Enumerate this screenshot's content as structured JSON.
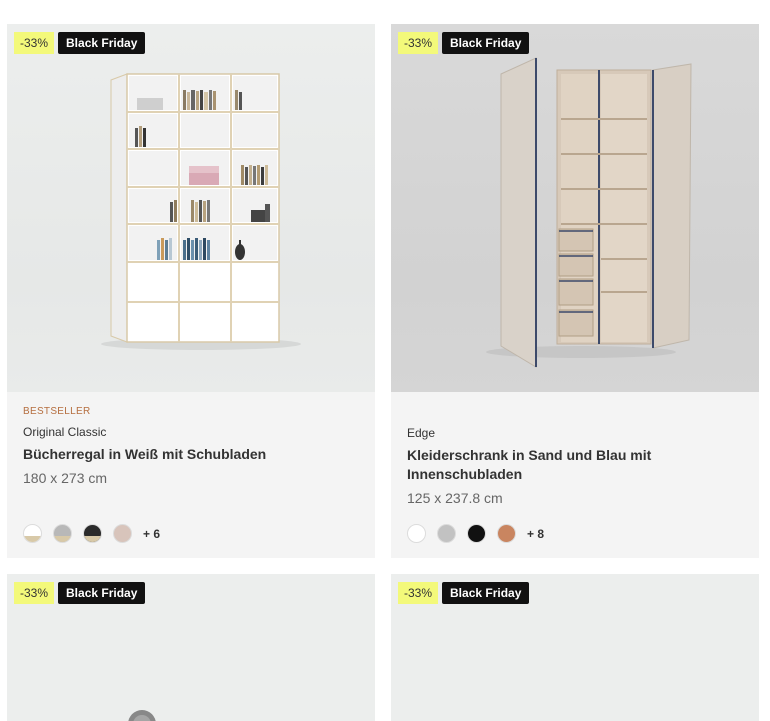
{
  "products": [
    {
      "discount": "-33%",
      "promo": "Black Friday",
      "tag": "BESTSELLER",
      "series": "Original Classic",
      "title": "Bücherregal in Weiß mit Schubladen",
      "dimensions": "180 x 273 cm",
      "swatches": [
        "#ffffff",
        "#b8b8b8",
        "#2b2b2b",
        "#d8c4bb"
      ],
      "more_colors": "+ 6"
    },
    {
      "discount": "-33%",
      "promo": "Black Friday",
      "tag": "",
      "series": "Edge",
      "title": "Kleiderschrank in Sand und Blau mit Innenschubladen",
      "dimensions": "125 x 237.8 cm",
      "swatches": [
        "#ffffff",
        "#c2c2c2",
        "#111111",
        "#c98560"
      ],
      "more_colors": "+ 8"
    },
    {
      "discount": "-33%",
      "promo": "Black Friday"
    },
    {
      "discount": "-33%",
      "promo": "Black Friday"
    }
  ]
}
